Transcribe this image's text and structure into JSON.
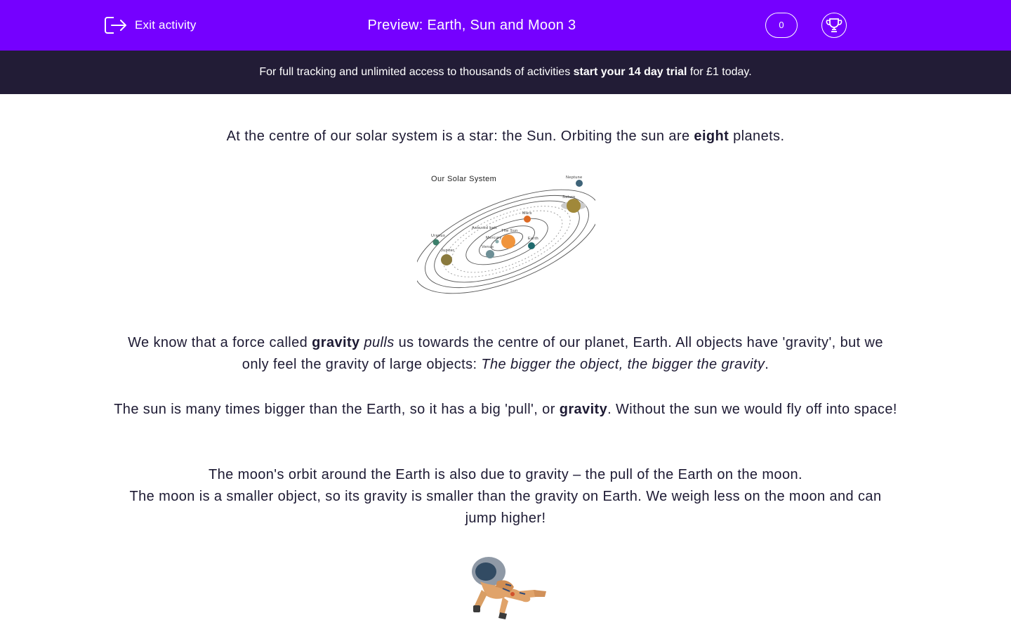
{
  "header": {
    "exit_label": "Exit activity",
    "title": "Preview: Earth, Sun and Moon 3",
    "score": "0",
    "background": "#7500ff"
  },
  "promo": {
    "text_before": "For full tracking and unlimited access to thousands of activities ",
    "text_bold": "start your 14 day trial",
    "text_after": " for £1 today.",
    "background": "#221c36"
  },
  "content": {
    "p1": {
      "a": "At the centre of our solar system is a star: the Sun. Orbiting the sun are ",
      "b": "eight",
      "c": " planets."
    },
    "diagram": {
      "title": "Our Solar System",
      "labels": {
        "neptune": "Neptune",
        "saturn": "Saturn",
        "mars": "Mars",
        "asteroid_belt": "Asteroid belt",
        "the_sun": "The Sun",
        "mercury": "Mercury",
        "earth": "Earth",
        "venus": "Venus",
        "uranus": "Uranus",
        "jupiter": "Jupiter"
      }
    },
    "p2": {
      "a": "We know that a force called ",
      "b": "gravity",
      "c": " ",
      "d": "pulls",
      "e": " us towards the centre of our planet, Earth. All objects have 'gravity', but we only feel the gravity of large objects: ",
      "f": "The bigger the object, the bigger the gravity",
      "g": "."
    },
    "p3": {
      "a": "The sun is many times bigger than the Earth, so it has a big 'pull', or ",
      "b": "gravity",
      "c": ". Without the sun we would fly off into space!"
    },
    "p4": "The moon's orbit around the Earth is also due to gravity – the pull of the Earth on the moon.",
    "p5": "The moon is a smaller object, so its gravity is smaller than the gravity on Earth. We weigh less on the moon and can jump higher!"
  }
}
